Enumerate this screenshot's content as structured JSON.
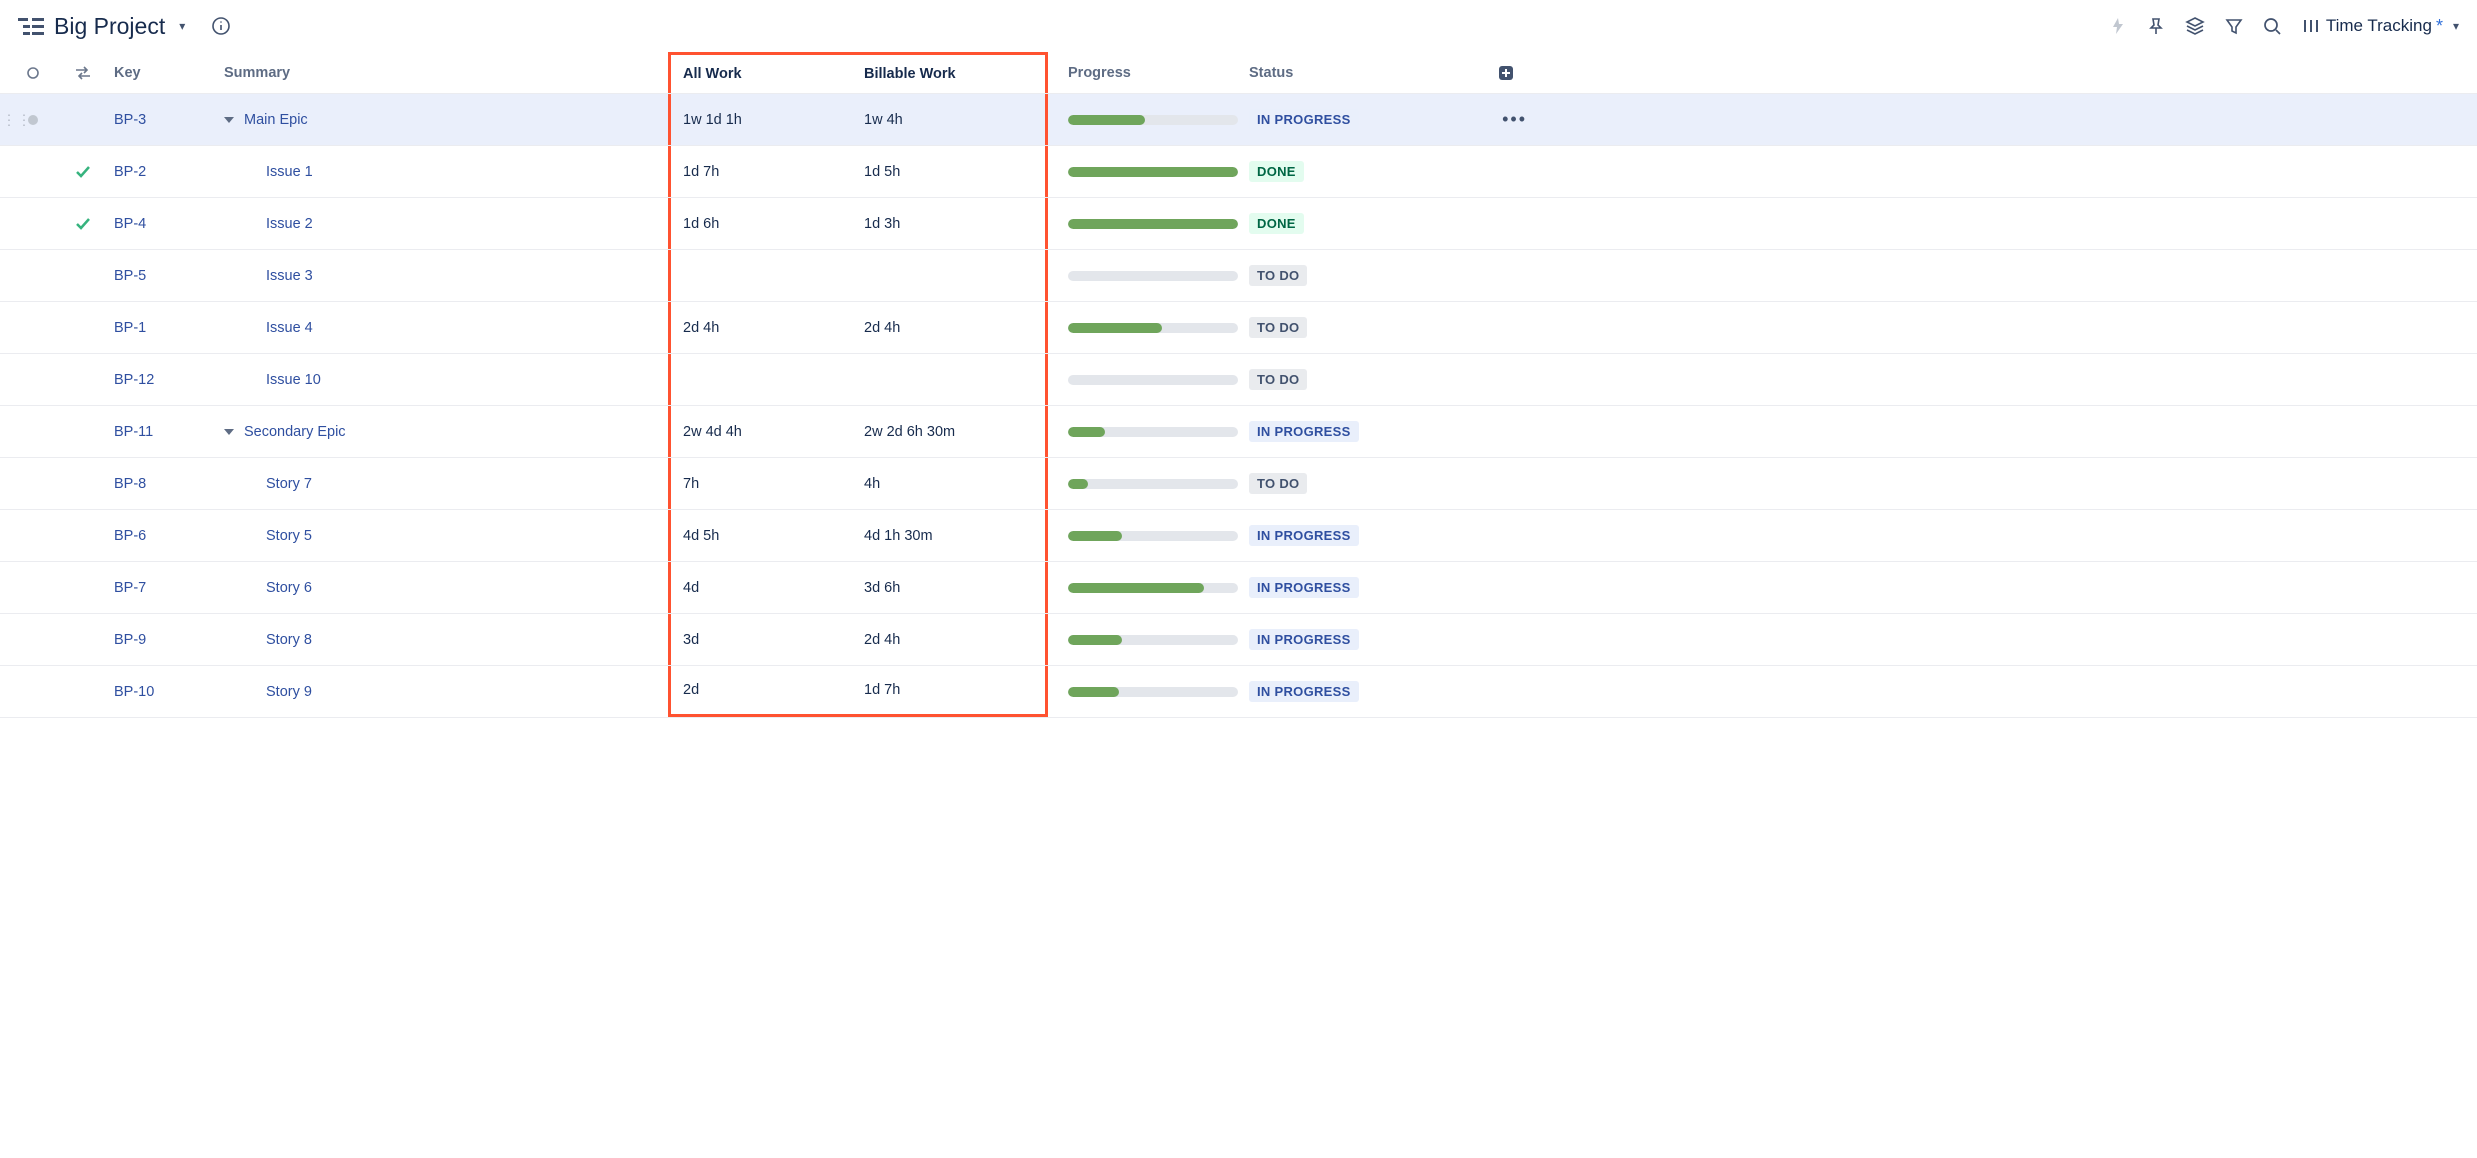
{
  "header": {
    "project_title": "Big Project",
    "view_name": "Time Tracking"
  },
  "columns": {
    "key": "Key",
    "summary": "Summary",
    "all_work": "All Work",
    "billable_work": "Billable Work",
    "progress": "Progress",
    "status": "Status"
  },
  "status_labels": {
    "todo": "TO DO",
    "done": "DONE",
    "in_progress": "IN PROGRESS"
  },
  "rows": [
    {
      "selected": true,
      "check": false,
      "dot": true,
      "key": "BP-3",
      "summary": "Main Epic",
      "indent": 0,
      "expandable": true,
      "all_work": "1w 1d 1h",
      "billable": "1w 4h",
      "progress": 45,
      "status": "in_progress"
    },
    {
      "selected": false,
      "check": true,
      "dot": false,
      "key": "BP-2",
      "summary": "Issue 1",
      "indent": 1,
      "expandable": false,
      "all_work": "1d 7h",
      "billable": "1d 5h",
      "progress": 100,
      "status": "done"
    },
    {
      "selected": false,
      "check": true,
      "dot": false,
      "key": "BP-4",
      "summary": "Issue 2",
      "indent": 1,
      "expandable": false,
      "all_work": "1d 6h",
      "billable": "1d 3h",
      "progress": 100,
      "status": "done"
    },
    {
      "selected": false,
      "check": false,
      "dot": false,
      "key": "BP-5",
      "summary": "Issue 3",
      "indent": 1,
      "expandable": false,
      "all_work": "",
      "billable": "",
      "progress": 0,
      "status": "todo"
    },
    {
      "selected": false,
      "check": false,
      "dot": false,
      "key": "BP-1",
      "summary": "Issue 4",
      "indent": 1,
      "expandable": false,
      "all_work": "2d 4h",
      "billable": "2d 4h",
      "progress": 55,
      "status": "todo"
    },
    {
      "selected": false,
      "check": false,
      "dot": false,
      "key": "BP-12",
      "summary": "Issue 10",
      "indent": 1,
      "expandable": false,
      "all_work": "",
      "billable": "",
      "progress": 0,
      "status": "todo"
    },
    {
      "selected": false,
      "check": false,
      "dot": false,
      "key": "BP-11",
      "summary": "Secondary Epic",
      "indent": 0,
      "expandable": true,
      "all_work": "2w 4d 4h",
      "billable": "2w 2d 6h 30m",
      "progress": 22,
      "status": "in_progress"
    },
    {
      "selected": false,
      "check": false,
      "dot": false,
      "key": "BP-8",
      "summary": "Story 7",
      "indent": 1,
      "expandable": false,
      "all_work": "7h",
      "billable": "4h",
      "progress": 12,
      "status": "todo"
    },
    {
      "selected": false,
      "check": false,
      "dot": false,
      "key": "BP-6",
      "summary": "Story 5",
      "indent": 1,
      "expandable": false,
      "all_work": "4d 5h",
      "billable": "4d 1h 30m",
      "progress": 32,
      "status": "in_progress"
    },
    {
      "selected": false,
      "check": false,
      "dot": false,
      "key": "BP-7",
      "summary": "Story 6",
      "indent": 1,
      "expandable": false,
      "all_work": "4d",
      "billable": "3d 6h",
      "progress": 80,
      "status": "in_progress"
    },
    {
      "selected": false,
      "check": false,
      "dot": false,
      "key": "BP-9",
      "summary": "Story 8",
      "indent": 1,
      "expandable": false,
      "all_work": "3d",
      "billable": "2d 4h",
      "progress": 32,
      "status": "in_progress"
    },
    {
      "selected": false,
      "check": false,
      "dot": false,
      "key": "BP-10",
      "summary": "Story 9",
      "indent": 1,
      "expandable": false,
      "all_work": "2d",
      "billable": "1d 7h",
      "progress": 30,
      "status": "in_progress"
    }
  ]
}
